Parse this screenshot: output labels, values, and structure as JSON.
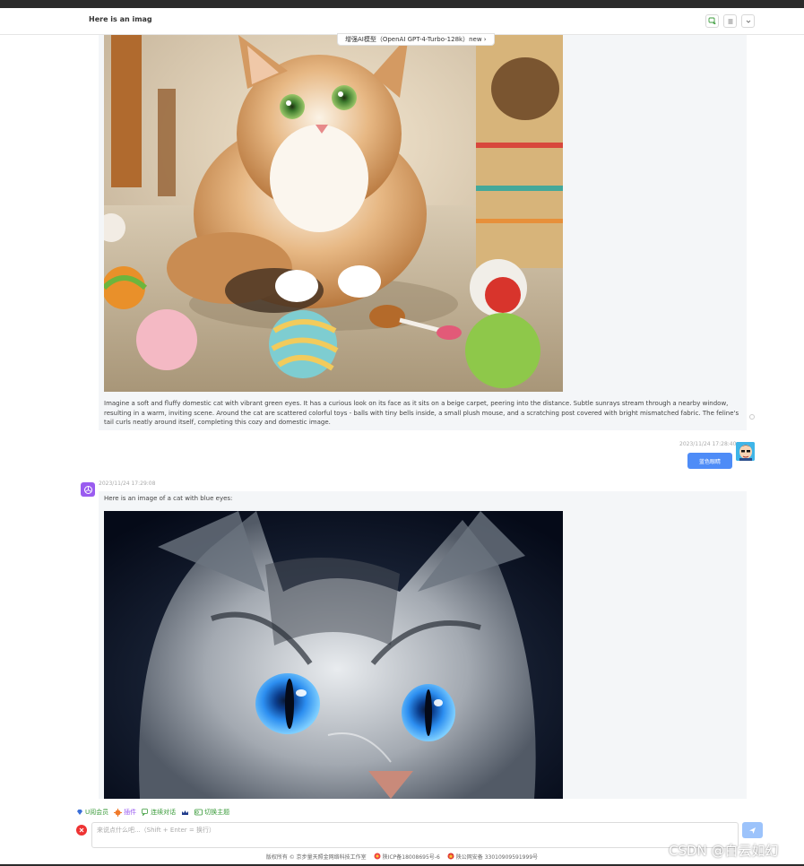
{
  "header": {
    "title": "Here is an imag",
    "model_pill": "增强AI模型（OpenAI GPT-4-Turbo-128k）new ›"
  },
  "messages": {
    "first_description": "Imagine a soft and fluffy domestic cat with vibrant green eyes. It has a curious look on its face as it sits on a beige carpet, peering into the distance. Subtle sunrays stream through a nearby window, resulting in a warm, inviting scene. Around the cat are scattered colorful toys - balls with tiny bells inside, a small plush mouse, and a scratching post covered with bright mismatched fabric. The feline's tail curls neatly around itself, completing this cozy and domestic image.",
    "user_timestamp": "2023/11/24 17:28:40",
    "user_message": "蓝色眼睛",
    "bot_timestamp": "2023/11/24 17:29:08",
    "bot_reply": "Here is an image of a cat with blue eyes:"
  },
  "toolbar": {
    "vip": "U阅会员",
    "plugins": "插件",
    "continuous": "连续对话",
    "theme": "切换主题"
  },
  "input": {
    "placeholder": "来说点什么吧...（Shift + Enter = 换行）"
  },
  "footer": {
    "copyright": "版权所有 © 京步量天照金网络科技工作室",
    "icp": "陕ICP备18008695号-6",
    "police": "陕公网安备 33010909591999号"
  },
  "watermark": "CSDN @白云如幻",
  "colors": {
    "accent": "#4e8cf7",
    "send": "#9cc3fb",
    "bubble": "#f4f6f8",
    "bot_avatar": "#9a5cf0"
  }
}
